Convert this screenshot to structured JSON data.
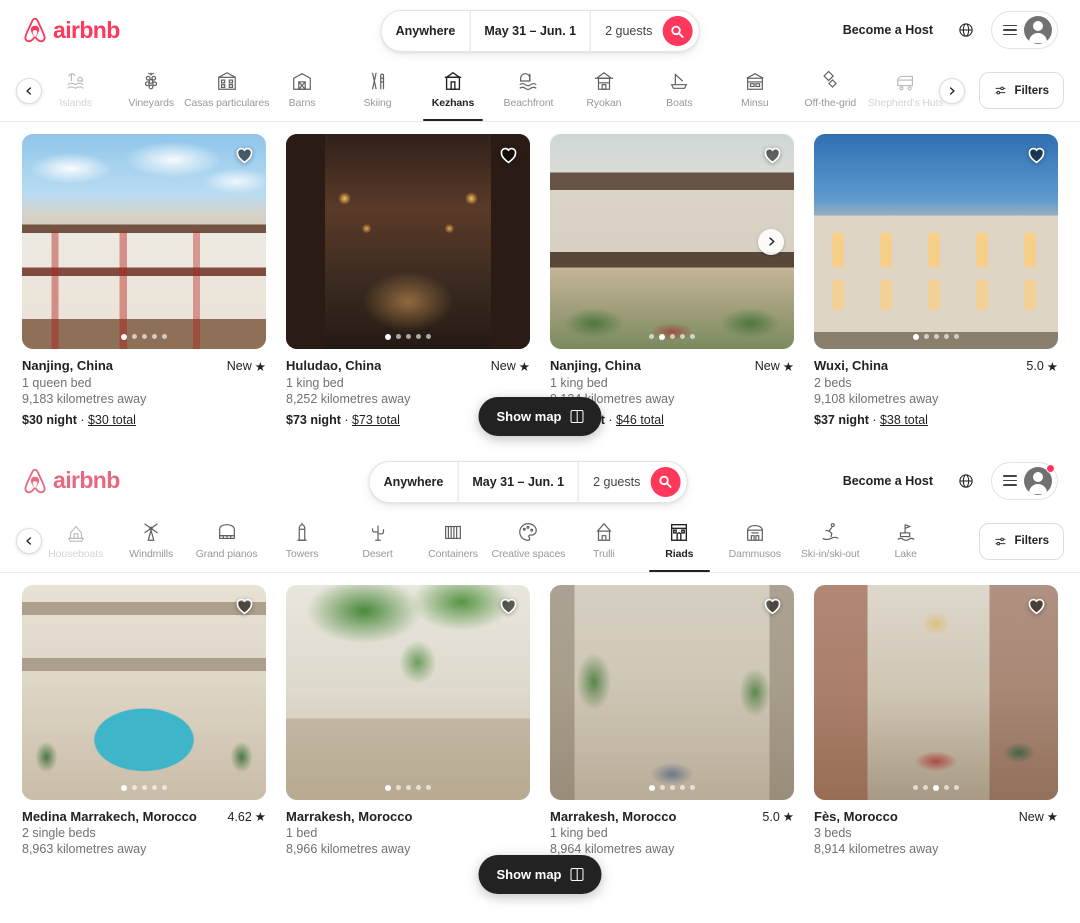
{
  "brand": {
    "name": "airbnb",
    "accent": "#FF385C"
  },
  "sections": [
    {
      "id": "section-kezhans",
      "header": {
        "logo_text": "airbnb",
        "search": {
          "location": "Anywhere",
          "dates": "May 31 – Jun. 1",
          "guests": "2 guests",
          "search_icon": "search-icon"
        },
        "become_host": "Become a Host",
        "globe_icon": "globe-icon",
        "menu_icon": "hamburger-menu-icon",
        "avatar_icon": "user-avatar-icon",
        "has_notification": false
      },
      "categories": [
        {
          "label": "Islands",
          "icon": "island-icon",
          "active": false,
          "faded": true
        },
        {
          "label": "Vineyards",
          "icon": "grapes-icon",
          "active": false,
          "faded": false
        },
        {
          "label": "Casas particulares",
          "icon": "casa-icon",
          "active": false,
          "faded": false
        },
        {
          "label": "Barns",
          "icon": "barn-icon",
          "active": false,
          "faded": false
        },
        {
          "label": "Skiing",
          "icon": "skis-icon",
          "active": false,
          "faded": false
        },
        {
          "label": "Kezhans",
          "icon": "kezhan-icon",
          "active": true,
          "faded": false
        },
        {
          "label": "Beachfront",
          "icon": "beachfront-icon",
          "active": false,
          "faded": false
        },
        {
          "label": "Ryokan",
          "icon": "ryokan-icon",
          "active": false,
          "faded": false
        },
        {
          "label": "Boats",
          "icon": "boat-icon",
          "active": false,
          "faded": false
        },
        {
          "label": "Minsu",
          "icon": "minsu-icon",
          "active": false,
          "faded": false
        },
        {
          "label": "Off-the-grid",
          "icon": "offgrid-icon",
          "active": false,
          "faded": false
        },
        {
          "label": "Shepherd's Huts",
          "icon": "shepherds-hut-icon",
          "active": false,
          "faded": true
        }
      ],
      "filters_label": "Filters",
      "prev_arrow": "chevron-left-icon",
      "next_arrow": "chevron-right-icon",
      "show_map": {
        "label": "Show map",
        "icon": "map-icon"
      },
      "listings": [
        {
          "title": "Nanjing, China",
          "rating": "New",
          "beds": "1 queen bed",
          "distance": "9,183 kilometres away",
          "price_night": "$30 night",
          "price_total": "$30 total",
          "dots": 5,
          "active_dot": 0,
          "has_next_arrow": false
        },
        {
          "title": "Huludao, China",
          "rating": "New",
          "beds": "1 king bed",
          "distance": "8,252 kilometres away",
          "price_night": "$73 night",
          "price_total": "$73 total",
          "dots": 5,
          "active_dot": 0,
          "has_next_arrow": false
        },
        {
          "title": "Nanjing, China",
          "rating": "New",
          "beds": "1 king bed",
          "distance": "9,124 kilometres away",
          "price_night": "$46 night",
          "price_total": "$46 total",
          "dots": 5,
          "active_dot": 1,
          "has_next_arrow": true
        },
        {
          "title": "Wuxi, China",
          "rating": "5.0",
          "beds": "2 beds",
          "distance": "9,108 kilometres away",
          "price_night": "$37 night",
          "price_total": "$38 total",
          "dots": 5,
          "active_dot": 0,
          "has_next_arrow": false
        }
      ]
    },
    {
      "id": "section-riads",
      "header": {
        "logo_text": "airbnb",
        "search": {
          "location": "Anywhere",
          "dates": "May 31 – Jun. 1",
          "guests": "2 guests",
          "search_icon": "search-icon"
        },
        "become_host": "Become a Host",
        "globe_icon": "globe-icon",
        "menu_icon": "hamburger-menu-icon",
        "avatar_icon": "user-avatar-icon",
        "has_notification": true
      },
      "categories": [
        {
          "label": "Houseboats",
          "icon": "houseboat-icon",
          "active": false,
          "faded": true
        },
        {
          "label": "Windmills",
          "icon": "windmill-icon",
          "active": false,
          "faded": false
        },
        {
          "label": "Grand pianos",
          "icon": "piano-icon",
          "active": false,
          "faded": false
        },
        {
          "label": "Towers",
          "icon": "tower-icon",
          "active": false,
          "faded": false
        },
        {
          "label": "Desert",
          "icon": "cactus-icon",
          "active": false,
          "faded": false
        },
        {
          "label": "Containers",
          "icon": "container-icon",
          "active": false,
          "faded": false
        },
        {
          "label": "Creative spaces",
          "icon": "palette-icon",
          "active": false,
          "faded": false
        },
        {
          "label": "Trulli",
          "icon": "trulli-icon",
          "active": false,
          "faded": false
        },
        {
          "label": "Riads",
          "icon": "riad-icon",
          "active": true,
          "faded": false
        },
        {
          "label": "Dammusos",
          "icon": "dammuso-icon",
          "active": false,
          "faded": false
        },
        {
          "label": "Ski-in/ski-out",
          "icon": "skier-icon",
          "active": false,
          "faded": false
        },
        {
          "label": "Lake",
          "icon": "lake-icon",
          "active": false,
          "faded": false
        }
      ],
      "filters_label": "Filters",
      "prev_arrow": "chevron-left-icon",
      "next_arrow": "chevron-right-icon",
      "show_map": {
        "label": "Show map",
        "icon": "map-icon"
      },
      "listings": [
        {
          "title": "Medina Marrakech, Morocco",
          "rating": "4.62",
          "beds": "2 single beds",
          "distance": "8,963 kilometres away",
          "price_night": "",
          "price_total": "",
          "dots": 5,
          "active_dot": 0,
          "has_next_arrow": false
        },
        {
          "title": "Marrakesh, Morocco",
          "rating": "",
          "beds": "1 bed",
          "distance": "8,966 kilometres away",
          "price_night": "",
          "price_total": "",
          "dots": 5,
          "active_dot": 0,
          "has_next_arrow": false
        },
        {
          "title": "Marrakesh, Morocco",
          "rating": "5.0",
          "beds": "1 king bed",
          "distance": "8,964 kilometres away",
          "price_night": "",
          "price_total": "",
          "dots": 5,
          "active_dot": 0,
          "has_next_arrow": false
        },
        {
          "title": "Fès, Morocco",
          "rating": "New",
          "beds": "3 beds",
          "distance": "8,914 kilometres away",
          "price_night": "",
          "price_total": "",
          "dots": 5,
          "active_dot": 2,
          "has_next_arrow": false
        }
      ]
    }
  ]
}
